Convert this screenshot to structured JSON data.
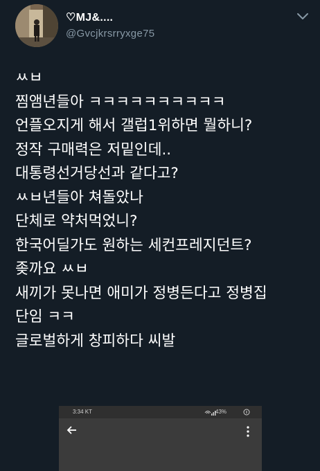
{
  "user": {
    "display_name": "♡MJ&....",
    "handle": "@Gvcjkrsrryxge75",
    "avatar_icon": "avatar-photo-icon"
  },
  "menu_icon": "chevron-down-icon",
  "tweet": {
    "lines": [
      "ㅆㅂ",
      "찜앰년들아 ㅋㅋㅋㅋㅋㅋㅋㅋㅋㅋ",
      "언플오지게 해서 갤럽1위하면 뭘하니?",
      "정작 구매력은 저밑인데..",
      "대통령선거당선과 같다고?",
      "ㅆㅂ년들아 쳐돌았나",
      "단체로 약처먹었니?",
      "한국어딜가도 원하는 세컨프레지던트?",
      "좆까요 ㅆㅂ",
      "새끼가 못나면 애미가 정병든다고 정병집",
      "단임 ㅋㅋ",
      "글로벌하게 창피하다 씨발"
    ]
  },
  "media": {
    "status_time": "3:34 KT",
    "status_battery": "43%",
    "back_icon": "arrow-left-icon",
    "more_icon": "more-vertical-icon"
  },
  "colors": {
    "background": "#141d26",
    "text": "#ffffff",
    "muted": "#8899a6"
  }
}
